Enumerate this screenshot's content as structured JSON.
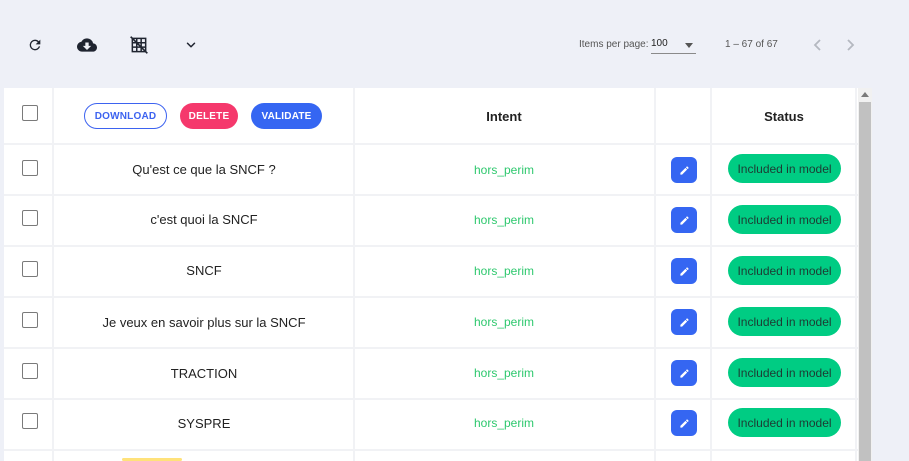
{
  "toolbar": {
    "icons": [
      "refresh-icon",
      "cloud-download-icon",
      "grid-off-icon",
      "chevron-down-icon"
    ]
  },
  "pagination": {
    "items_per_page_label": "Items per page:",
    "items_per_page_value": "100",
    "range_label": "1 – 67 of 67"
  },
  "table": {
    "actions": {
      "download": "DOWNLOAD",
      "delete": "DELETE",
      "validate": "VALIDATE"
    },
    "headers": {
      "intent": "Intent",
      "status": "Status"
    },
    "rows": [
      {
        "text": "Qu'est ce que la SNCF ?",
        "intent": "hors_perim",
        "status": "Included in model"
      },
      {
        "text": "c'est quoi la SNCF",
        "intent": "hors_perim",
        "status": "Included in model"
      },
      {
        "text": "SNCF",
        "intent": "hors_perim",
        "status": "Included in model"
      },
      {
        "text": "Je veux en savoir plus sur la SNCF",
        "intent": "hors_perim",
        "status": "Included in model"
      },
      {
        "text": "TRACTION",
        "intent": "hors_perim",
        "status": "Included in model"
      },
      {
        "text": "SYSPRE",
        "intent": "hors_perim",
        "status": "Included in model"
      }
    ]
  },
  "colors": {
    "background": "#eef0f7",
    "primary": "#3566f2",
    "danger": "#f5386c",
    "success": "#00cc83",
    "intent_text": "#2ec86e"
  }
}
